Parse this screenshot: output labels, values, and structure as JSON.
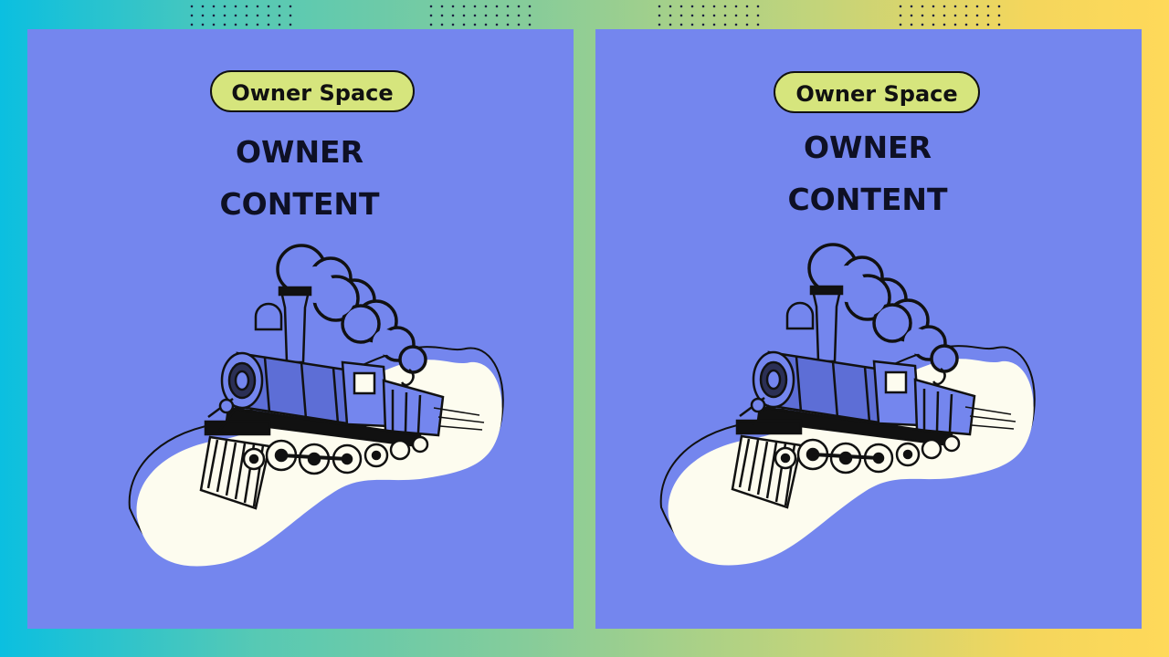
{
  "panels": [
    {
      "badge": "Owner Space",
      "title_line1": "OWNER",
      "title_line2": "CONTENT"
    },
    {
      "badge": "Owner Space",
      "title_line1": "OWNER",
      "title_line2": "CONTENT"
    }
  ],
  "colors": {
    "panel": "#7486ee",
    "badge": "#d6e57d",
    "blob": "#fdfcef",
    "ink": "#0e1024"
  },
  "icons": [
    "steam-locomotive-icon",
    "smoke-cloud-icon",
    "dot-grid-pattern"
  ]
}
